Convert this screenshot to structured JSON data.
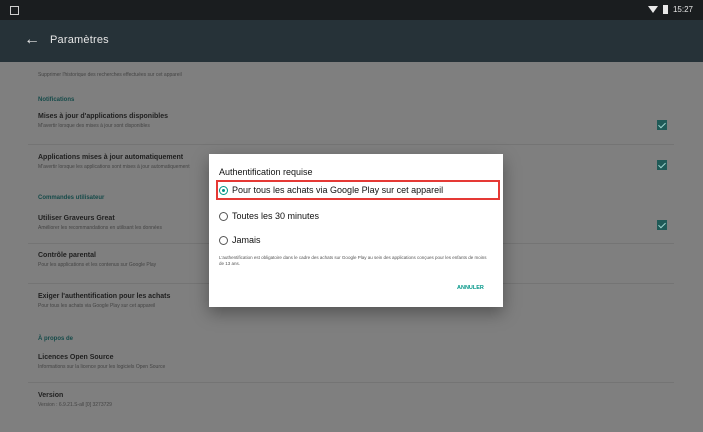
{
  "status_bar": {
    "time": "15:27"
  },
  "app_bar": {
    "back_glyph": "←",
    "title": "Paramètres"
  },
  "settings": {
    "truncated_top_text": "Supprimer l'historique des recherches effectuées sur cet appareil",
    "sections": [
      {
        "header": "Notifications",
        "items": [
          {
            "title": "Mises à jour d'applications disponibles",
            "subtitle": "M'avertir lorsque des mises à jour sont disponibles",
            "checked": true
          },
          {
            "title": "Applications mises à jour automatiquement",
            "subtitle": "M'avertir lorsque les applications sont mises à jour automatiquement",
            "checked": true
          }
        ]
      },
      {
        "header": "Commandes utilisateur",
        "items": [
          {
            "title": "Utiliser Graveurs Great",
            "subtitle": "Améliorer les recommandations en utilisant les données",
            "checked": true
          },
          {
            "title": "Contrôle parental",
            "subtitle": "Pour les applications et les contenus sur Google Play"
          },
          {
            "title": "Exiger l'authentification pour les achats",
            "subtitle": "Pour tous les achats via Google Play sur cet appareil"
          }
        ]
      },
      {
        "header": "À propos de",
        "items": [
          {
            "title": "Licences Open Source",
            "subtitle": "Informations sur la licence pour les logiciels Open Source"
          },
          {
            "title": "Version",
            "subtitle": "Version : 6.9.21.S-all [0] 3273729"
          }
        ]
      }
    ]
  },
  "dialog": {
    "title": "Authentification requise",
    "options": [
      {
        "label": "Pour tous les achats via Google Play sur cet appareil",
        "selected": true
      },
      {
        "label": "Toutes les 30 minutes",
        "selected": false
      },
      {
        "label": "Jamais",
        "selected": false
      }
    ],
    "note": "L'authentification est obligatoire dans le cadre des achats sur Google Play au sein des applications conçues pour les enfants de moins de 13 ans.",
    "cancel_label": "ANNULER"
  },
  "colors": {
    "accent": "#009688",
    "app_bar": "#263238",
    "highlight": "#e53935"
  }
}
